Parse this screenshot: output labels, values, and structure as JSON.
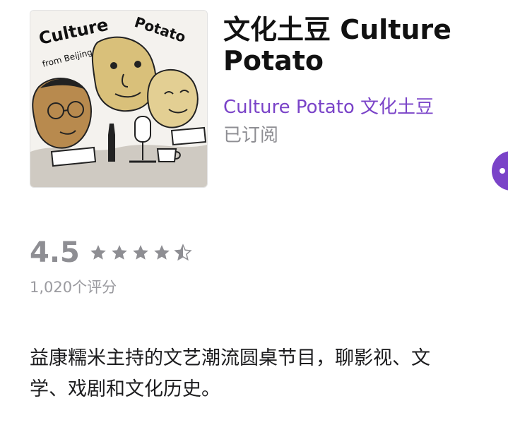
{
  "podcast": {
    "title": "文化土豆 Culture Potato",
    "author": "Culture Potato 文化土豆",
    "subscription_status": "已订阅",
    "artwork": {
      "text_culture": "Culture",
      "text_potato": "Potato",
      "text_from": "from Beijing"
    }
  },
  "rating": {
    "value": "4.5",
    "count_text": "1,020个评分",
    "stars_filled_fraction": 0.9,
    "star_icons": [
      "star-full-icon",
      "star-full-icon",
      "star-full-icon",
      "star-full-icon",
      "star-half-icon"
    ]
  },
  "description": {
    "text": "益康糯米主持的文艺潮流圆桌节目，聊影视、文\n学、戏剧和文化历史。"
  },
  "colors": {
    "accent": "#7a43c8",
    "secondary_text": "#8e8e93",
    "star": "#8e8e93"
  }
}
